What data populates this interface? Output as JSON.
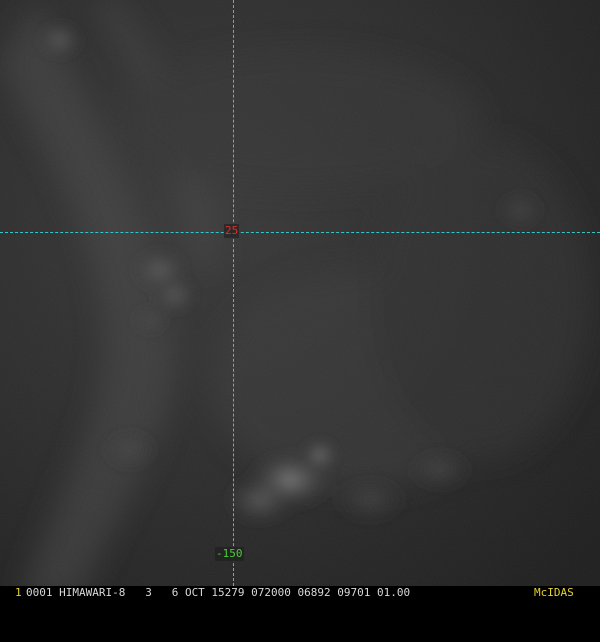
{
  "image": {
    "description_icon": "satellite-imagery-icon",
    "grid_color": "#35c6c6",
    "background_color": "#2b2b2b"
  },
  "overlay": {
    "lat_label": "25",
    "lat_label_color": "#d83030",
    "lon_label": "-150",
    "lon_label_color": "#4ccd36"
  },
  "status_bar": {
    "frame_number": "1",
    "text": "0001 HIMAWARI-8   3   6 OCT 15279 072000 06892 09701 01.00",
    "software": "McIDAS",
    "highlight_color": "#e6d22e"
  }
}
